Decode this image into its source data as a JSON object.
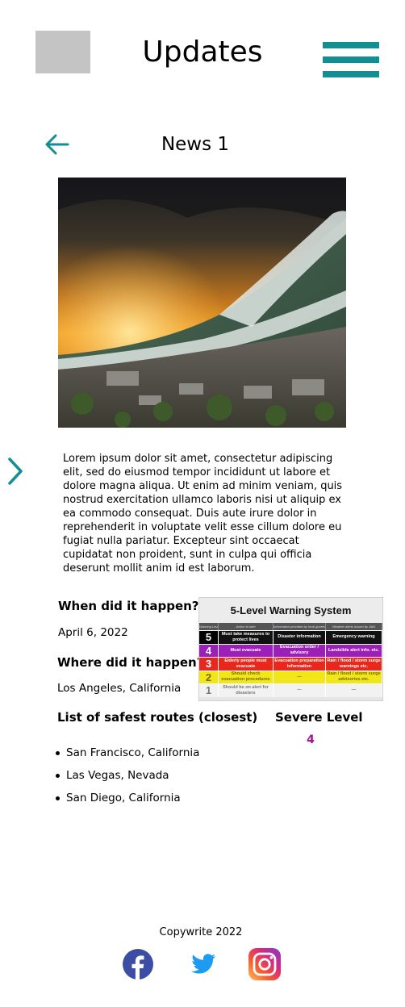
{
  "header": {
    "title": "Updates"
  },
  "article": {
    "title": "News 1",
    "body": "Lorem ipsum dolor sit amet, consectetur adipiscing elit, sed do eiusmod tempor incididunt ut labore et dolore magna aliqua. Ut enim ad minim veniam, quis nostrud exercitation ullamco laboris nisi ut aliquip ex ea commodo consequat. Duis aute irure dolor in reprehenderit in voluptate velit esse cillum dolore eu fugiat nulla pariatur. Excepteur sint occaecat cupidatat non proident, sunt in culpa qui officia deserunt mollit anim id est laborum.",
    "when_label": "When did it happen?",
    "when_value": "April 6, 2022",
    "where_label": "Where did it happen?",
    "where_value": "Los Angeles, California",
    "routes_label": "List of safest routes (closest)",
    "routes": [
      "San Francisco, California",
      "Las Vegas, Nevada",
      "San Diego, California"
    ],
    "severe_label": "Severe Level",
    "severe_value": "4"
  },
  "warning_system": {
    "title": "5-Level Warning System",
    "headers": [
      "Warning Level",
      "Action to take",
      "Information provided by local government",
      "Weather alerts issued by JMA"
    ],
    "rows": [
      {
        "level": "5",
        "action": "Must take measures to protect lives",
        "info": "Disaster information",
        "alert": "Emergency warning",
        "color": "#111111",
        "text": "#ffffff"
      },
      {
        "level": "4",
        "action": "Must evacuate",
        "info": "Evacuation order / advisory",
        "alert": "Landslide alert info. etc.",
        "color": "#9b1fb8",
        "text": "#ffffff"
      },
      {
        "level": "3",
        "action": "Elderly people must evacuate",
        "info": "Evacuation preparation information",
        "alert": "Rain / flood / storm surge warnings etc.",
        "color": "#e8281c",
        "text": "#ffffff"
      },
      {
        "level": "2",
        "action": "Should check evacuation procedures",
        "info": "—",
        "alert": "Rain / flood / storm surge advisories etc.",
        "color": "#f0e619",
        "text": "#7a6a00"
      },
      {
        "level": "1",
        "action": "Should be on alert for disasters",
        "info": "—",
        "alert": "—",
        "color": "#f2f2f2",
        "text": "#777777"
      }
    ]
  },
  "footer": {
    "copyright": "Copywrite 2022"
  },
  "colors": {
    "accent": "#138f94",
    "severe": "#a0148c",
    "facebook": "#3b4ea3",
    "twitter": "#1d9bf0"
  }
}
